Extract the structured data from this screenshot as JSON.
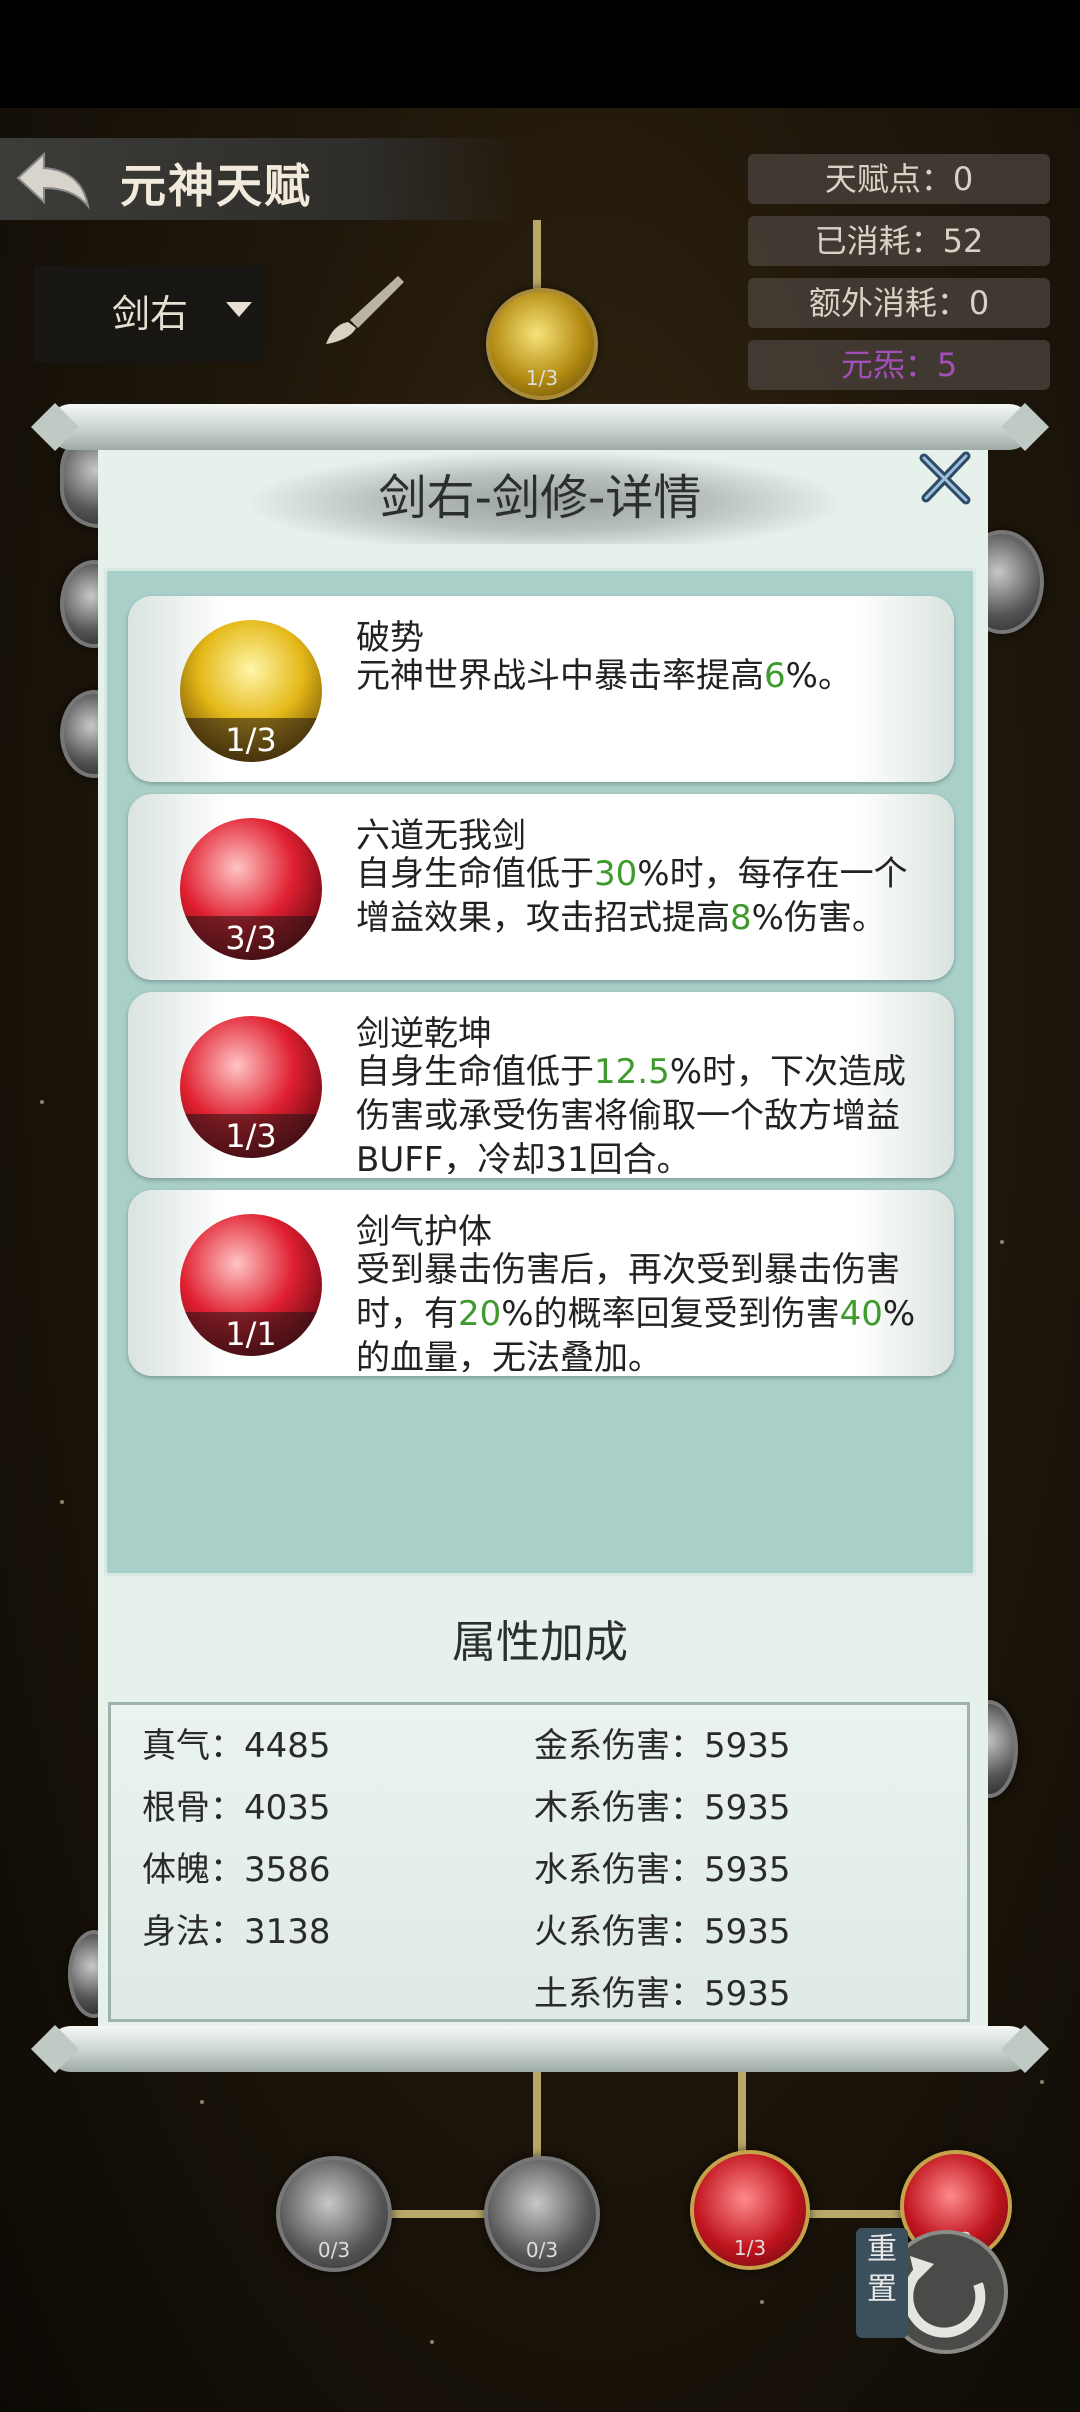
{
  "header": {
    "title": "元神天赋"
  },
  "stats": [
    "天赋点：0",
    "已消耗：52",
    "额外消耗：0",
    "元炁：5"
  ],
  "stats_accent": "#a44fb8",
  "dropdown": {
    "value": "剑右"
  },
  "tree_nodes": [
    "1/3",
    "0/3",
    "0/3",
    "1/3",
    "3/3"
  ],
  "reset_button": "重置",
  "dialog": {
    "title": "剑右-剑修-详情",
    "talents": [
      {
        "name": "破势",
        "desc_parts": [
          "元神世界战斗中暴击率提高",
          "6",
          "%。"
        ],
        "level": "1/3",
        "color": "gold"
      },
      {
        "name": "六道无我剑",
        "desc_parts": [
          "自身生命值低于",
          "30",
          "%时，每存在一个增益效果，攻击招式提高",
          "8",
          "%伤害。"
        ],
        "level": "3/3",
        "color": "red"
      },
      {
        "name": "剑逆乾坤",
        "desc_parts": [
          "自身生命值低于",
          "12.5",
          "%时，下次造成伤害或承受伤害将偷取一个敌方增益BUFF，冷却31回合。"
        ],
        "level": "1/3",
        "color": "red"
      },
      {
        "name": "剑气护体",
        "desc_parts": [
          "受到暴击伤害后，再次受到暴击伤害时，有",
          "20",
          "%的概率回复受到伤害",
          "40",
          "%的血量，无法叠加。"
        ],
        "level": "1/1",
        "color": "red"
      }
    ],
    "attributes_title": "属性加成",
    "attributes_left": [
      "真气：4485",
      "根骨：4035",
      "体魄：3586",
      "身法：3138"
    ],
    "attributes_right": [
      "金系伤害：5935",
      "木系伤害：5935",
      "水系伤害：5935",
      "火系伤害：5935",
      "土系伤害：5935"
    ]
  }
}
